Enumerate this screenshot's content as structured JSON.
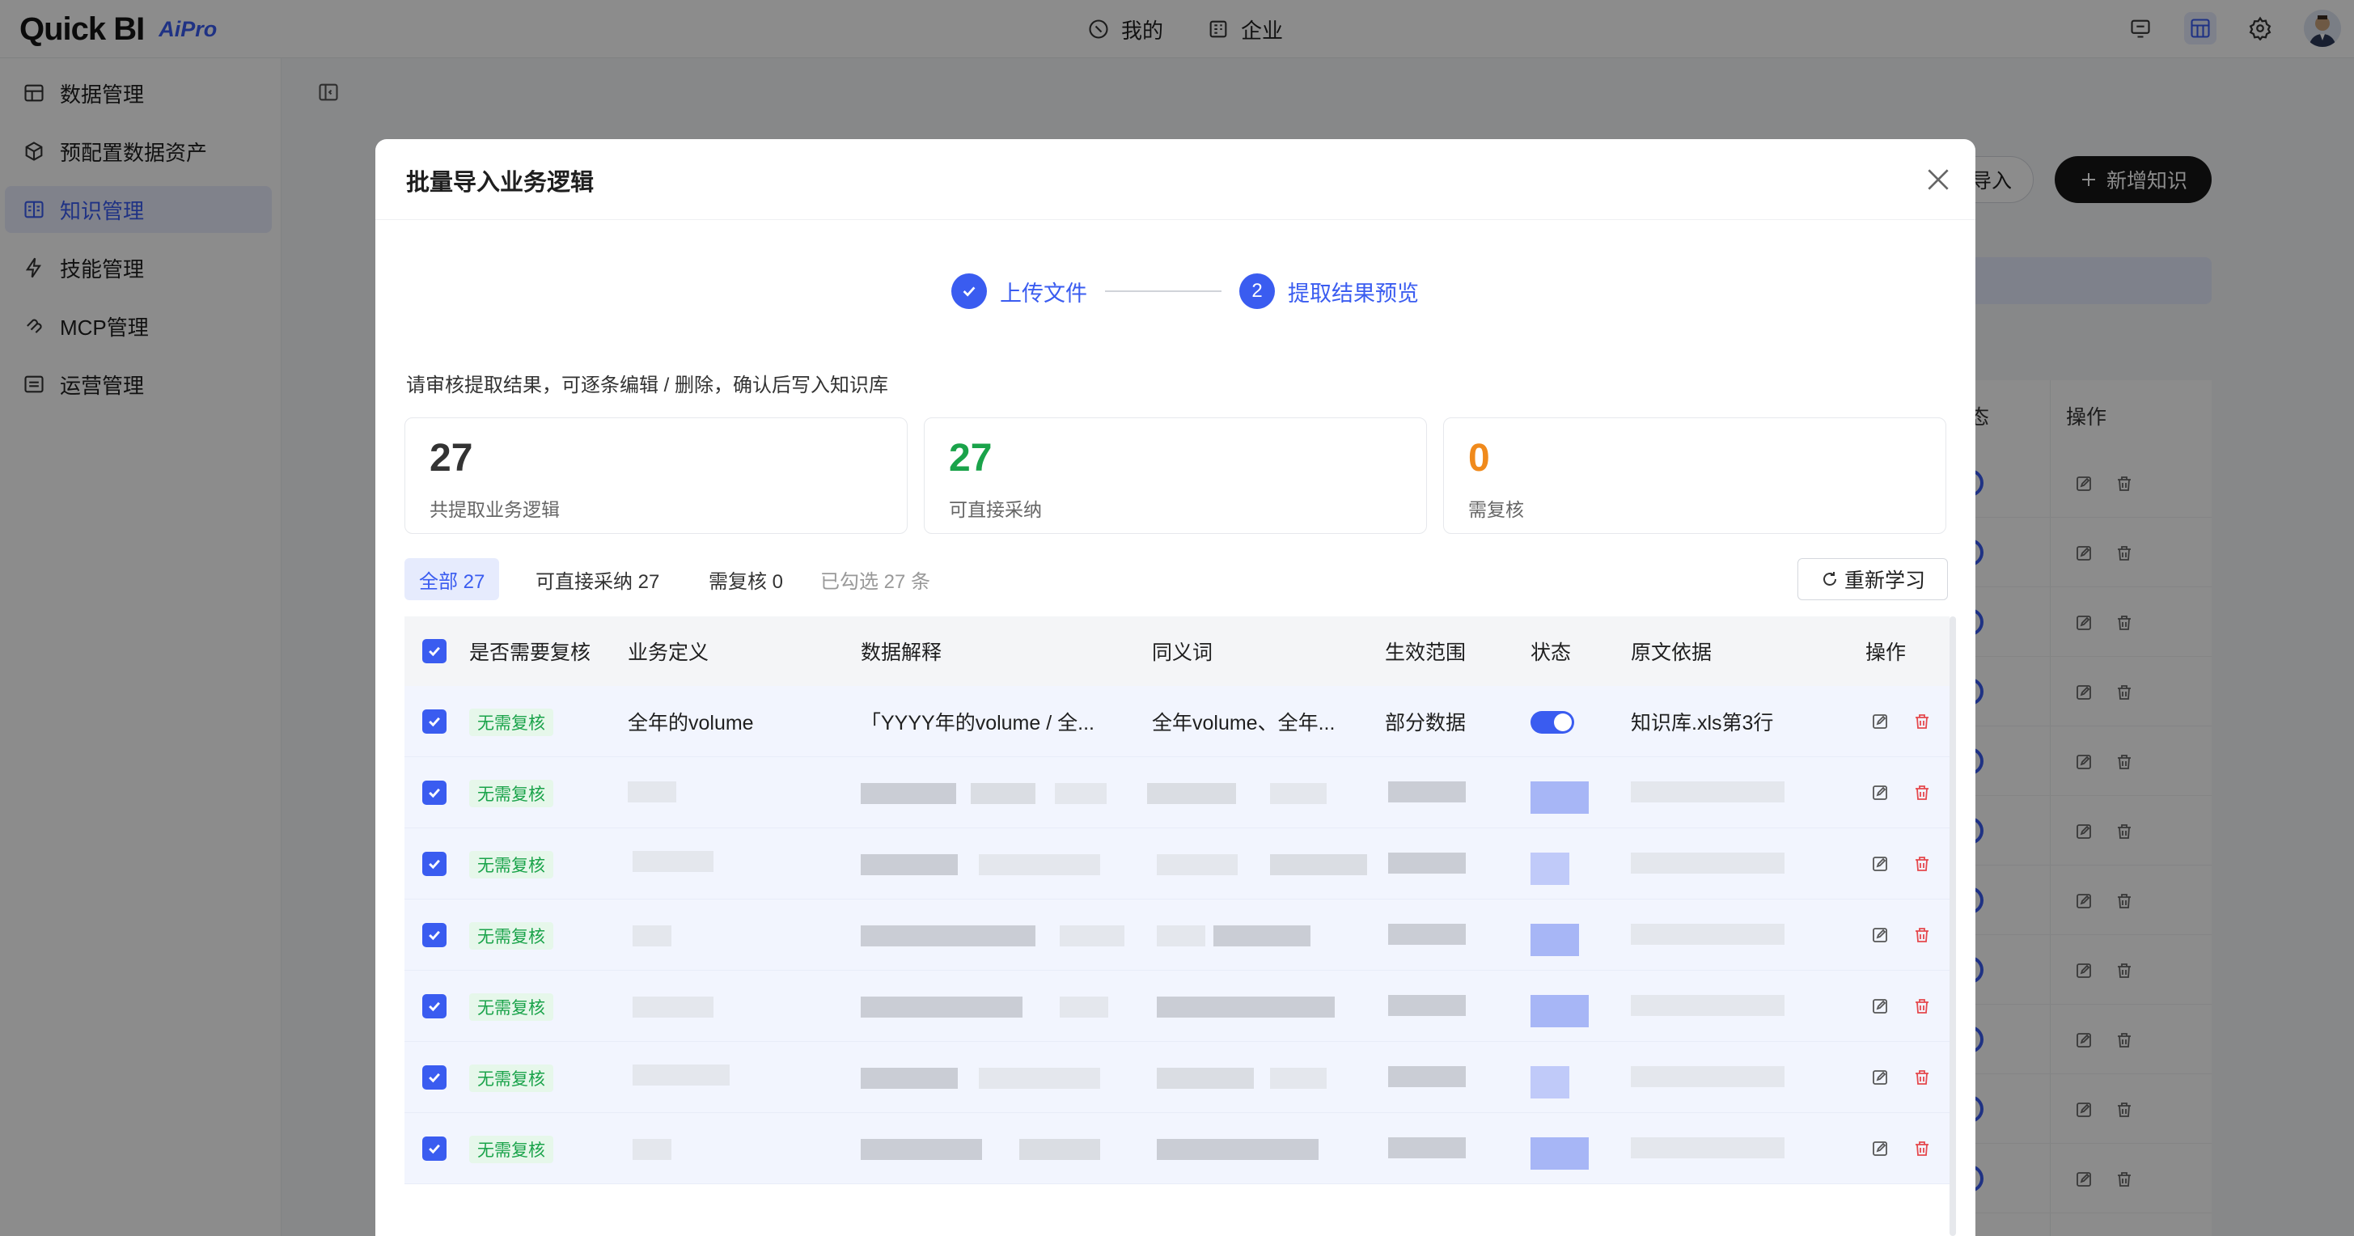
{
  "header": {
    "logo_main": "Quick BI",
    "logo_sub": "AiPro",
    "nav": [
      {
        "label": "我的",
        "icon": "clock-icon"
      },
      {
        "label": "企业",
        "icon": "building-icon"
      }
    ],
    "right_icons": [
      "monitor-icon",
      "dashboard-icon",
      "gear-icon",
      "avatar"
    ]
  },
  "sidebar": {
    "items": [
      {
        "label": "数据管理",
        "icon": "data-grid-icon",
        "active": false
      },
      {
        "label": "预配置数据资产",
        "icon": "cube-icon",
        "active": false
      },
      {
        "label": "知识管理",
        "icon": "book-icon",
        "active": true
      },
      {
        "label": "技能管理",
        "icon": "lightning-icon",
        "active": false
      },
      {
        "label": "MCP管理",
        "icon": "mcp-icon",
        "active": false
      },
      {
        "label": "运营管理",
        "icon": "list-icon",
        "active": false
      }
    ]
  },
  "background": {
    "import_button": "导入",
    "new_button": "新增知识",
    "status_header": "态",
    "action_header": "操作"
  },
  "modal": {
    "title": "批量导入业务逻辑",
    "steps": [
      {
        "index": "1",
        "label": "上传文件",
        "done": true
      },
      {
        "index": "2",
        "label": "提取结果预览",
        "done": false
      }
    ],
    "hint": "请审核提取结果，可逐条编辑 / 删除，确认后写入知识库",
    "stats": [
      {
        "value": "27",
        "label": "共提取业务逻辑",
        "color": "#333333"
      },
      {
        "value": "27",
        "label": "可直接采纳",
        "color": "#1aa34a"
      },
      {
        "value": "0",
        "label": "需复核",
        "color": "#f08a1c"
      }
    ],
    "filters": {
      "all": "全部 27",
      "adoptable": "可直接采纳 27",
      "review": "需复核 0",
      "selected": "已勾选 27 条"
    },
    "relearn_button": "重新学习",
    "table": {
      "columns": [
        "是否需要复核",
        "业务定义",
        "数据解释",
        "同义词",
        "生效范围",
        "状态",
        "原文依据",
        "操作"
      ],
      "rows": [
        {
          "review": "无需复核",
          "definition": "全年的volume",
          "explanation": "「YYYY年的volume / 全...",
          "synonyms": "全年volume、全年...",
          "scope": "部分数据",
          "enabled": true,
          "source": "知识库.xls第3行"
        },
        {
          "review": "无需复核",
          "blurred": true
        },
        {
          "review": "无需复核",
          "blurred": true
        },
        {
          "review": "无需复核",
          "blurred": true
        },
        {
          "review": "无需复核",
          "blurred": true
        },
        {
          "review": "无需复核",
          "blurred": true
        },
        {
          "review": "无需复核",
          "blurred": true
        }
      ]
    }
  },
  "colors": {
    "accent": "#3a5cf0",
    "success": "#1aa34a",
    "warning": "#f08a1c",
    "danger": "#e5484d"
  }
}
